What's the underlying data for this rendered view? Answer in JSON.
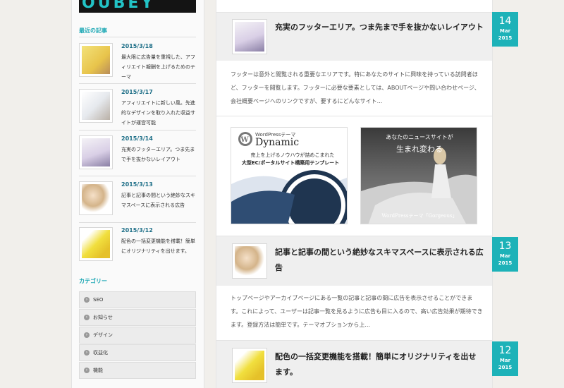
{
  "logo": {
    "text": "OUBEY"
  },
  "sidebar": {
    "recent_heading": "最近の記事",
    "recent": [
      {
        "date": "2015/3/18",
        "text": "最大限に広告量を重視した、アフィリエイト報酬を上げるためのテーマ"
      },
      {
        "date": "2015/3/17",
        "text": "アフィリエイトに新しい風。先進的なデザインを取り入れた収益サイトが運営可能"
      },
      {
        "date": "2015/3/14",
        "text": "充実のフッターエリア。つま先まで手を抜かないレイアウト"
      },
      {
        "date": "2015/3/13",
        "text": "記事と記事の間という絶妙なスキマスペースに表示される広告"
      },
      {
        "date": "2015/3/12",
        "text": "配色の一括変更機能を搭載！簡単にオリジナリティを出せます。"
      }
    ],
    "category_heading": "カテゴリー",
    "categories": [
      "SEO",
      "お知らせ",
      "デザイン",
      "収益化",
      "機能"
    ]
  },
  "posts": [
    {
      "day": "14",
      "month": "Mar",
      "year": "2015",
      "title": "充実のフッターエリア。つま先まで手を抜かないレイアウト",
      "excerpt": "フッターは意外と閲覧される重要なエリアです。特にあなたのサイトに興味を持っている訪問者ほど、フッターを閲覧します。フッターに必要な要素としては、ABOUTページや問い合わせページ、会社概要ページへのリンクですが、要するにどんなサイト..."
    },
    {
      "day": "13",
      "month": "Mar",
      "year": "2015",
      "title": "記事と記事の間という絶妙なスキマスペースに表示される広告",
      "excerpt": "トップページやアーカイブページにある一覧の記事と記事の間に広告を表示させることができます。これによって、ユーザーは記事一覧を見るように広告も目に入るので、高い広告効果が期待できます。登録方法は簡単です。テーマオプションから上..."
    },
    {
      "day": "12",
      "month": "Mar",
      "year": "2015",
      "title": "配色の一括変更機能を搭載！簡単にオリジナリティを出せます。",
      "excerpt": ""
    }
  ],
  "ads": {
    "ad1": {
      "small": "WordPressテーマ",
      "big": "Dynamic",
      "line1": "売上を上げるノウハウが詰めこまれた",
      "line2": "大型EC/ポータルサイト構築用テンプレート"
    },
    "ad2": {
      "line1": "あなたのニュースサイトが",
      "line2": "生まれ変わる",
      "bottom": "WordPressテーマ「Gorgeous」"
    }
  }
}
